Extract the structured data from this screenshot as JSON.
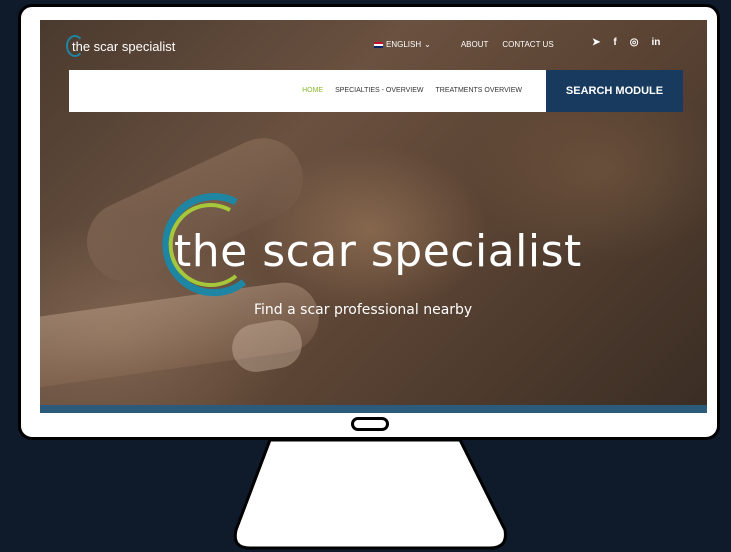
{
  "site": {
    "logo_text": "the scar specialist",
    "language": "ENGLISH",
    "top_links": [
      "ABOUT",
      "CONTACT US"
    ],
    "social": [
      "twitter-icon",
      "facebook-icon",
      "instagram-icon",
      "linkedin-icon"
    ]
  },
  "nav": {
    "items": [
      "HOME",
      "SPECIALTIES - OVERVIEW",
      "TREATMENTS OVERVIEW"
    ],
    "active": "HOME",
    "search_button": "SEARCH MODULE"
  },
  "hero": {
    "title": "the scar specialist",
    "subtitle": "Find a scar professional nearby"
  },
  "colors": {
    "background": "#0f1a2b",
    "nav_active": "#8bb830",
    "search_button": "#183a5e",
    "logo_ring_blue": "#1e86a3",
    "logo_ring_green": "#a6c73a"
  }
}
